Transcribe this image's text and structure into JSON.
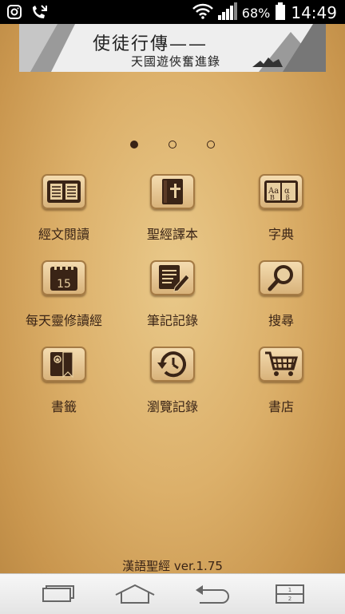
{
  "status_bar": {
    "battery": "68%",
    "time": "14:49",
    "icons": [
      "instagram-icon",
      "missed-call-icon",
      "wifi-icon",
      "signal-icon",
      "battery-icon"
    ]
  },
  "banner": {
    "title": "使徒行傳——",
    "subtitle": "天國遊俠奮進錄"
  },
  "pager": {
    "pages": 3,
    "current": 1
  },
  "menu": [
    {
      "label": "經文閱讀",
      "icon": "book-icon"
    },
    {
      "label": "聖經譯本",
      "icon": "bible-icon"
    },
    {
      "label": "字典",
      "icon": "dictionary-icon"
    },
    {
      "label": "每天靈修讀經",
      "icon": "calendar-icon"
    },
    {
      "label": "筆記記錄",
      "icon": "notes-icon"
    },
    {
      "label": "搜尋",
      "icon": "search-icon"
    },
    {
      "label": "書籤",
      "icon": "bookmark-icon"
    },
    {
      "label": "瀏覽記錄",
      "icon": "history-icon"
    },
    {
      "label": "書店",
      "icon": "cart-icon"
    }
  ],
  "calendar_day": "15",
  "version": "漢語聖經 ver.1.75",
  "colors": {
    "accent": "#3a2416",
    "background": "#dcb06a"
  }
}
